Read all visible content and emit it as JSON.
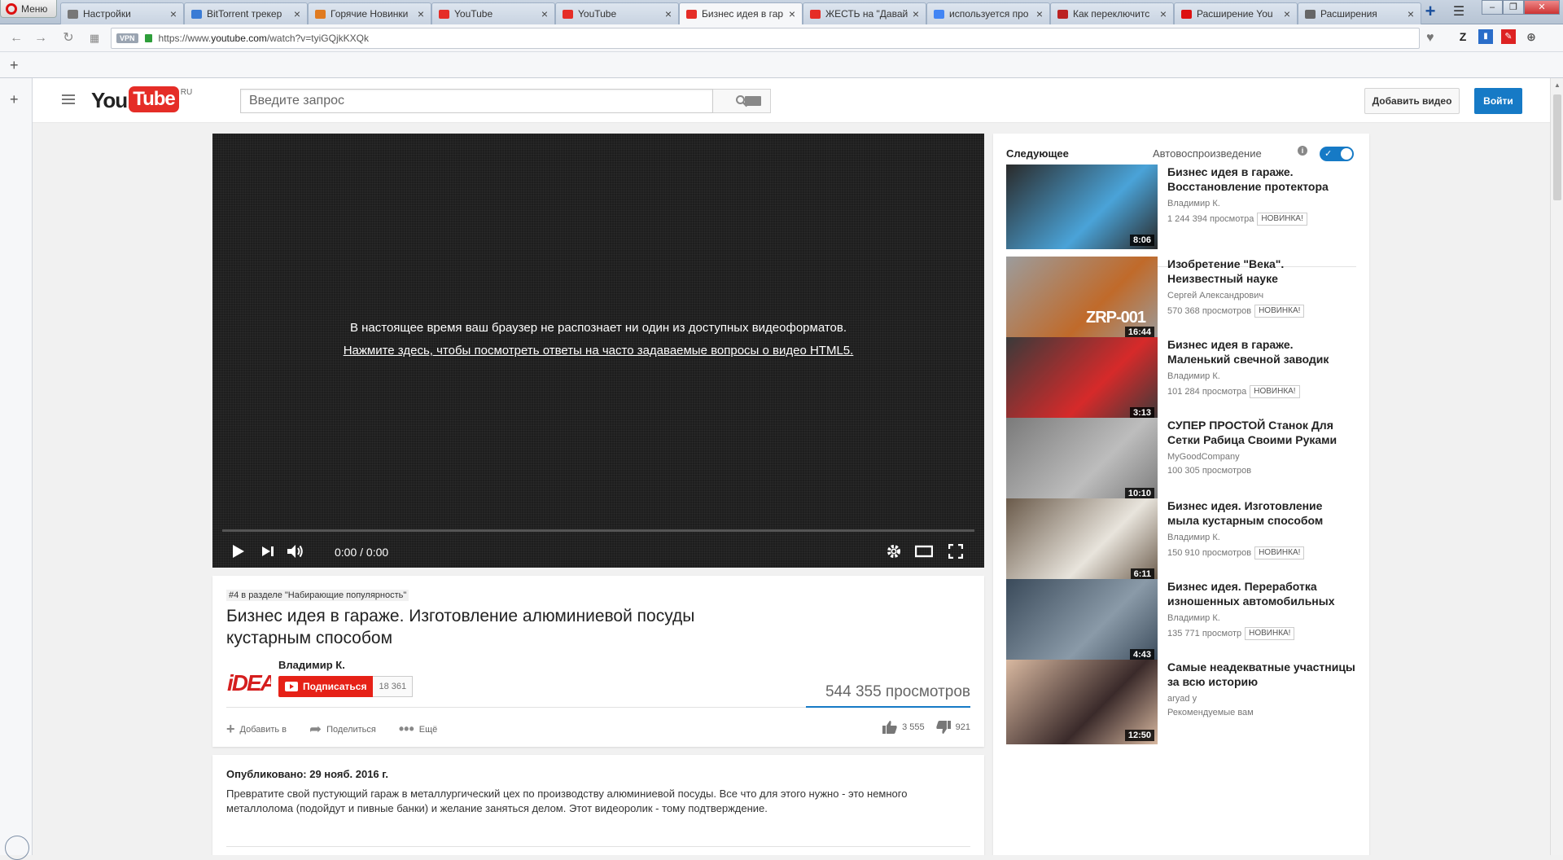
{
  "browser": {
    "menu_label": "Меню",
    "tabs": [
      {
        "label": "Настройки",
        "fav": "#777"
      },
      {
        "label": "BitTorrent трекер",
        "fav": "#3a7bd5"
      },
      {
        "label": "Горячие Новинки",
        "fav": "#e07b20"
      },
      {
        "label": "YouTube",
        "fav": "#e52d27"
      },
      {
        "label": "YouTube",
        "fav": "#e52d27"
      },
      {
        "label": "Бизнес идея в гар",
        "fav": "#e52d27"
      },
      {
        "label": "ЖЕСТЬ на \"Давай",
        "fav": "#e52d27"
      },
      {
        "label": "используется про",
        "fav": "#4285f4"
      },
      {
        "label": "Как переключитс",
        "fav": "#b22"
      },
      {
        "label": "Расширение You",
        "fav": "#d11"
      },
      {
        "label": "Расширения",
        "fav": "#666"
      }
    ],
    "active_tab": 5,
    "vpn_label": "VPN",
    "url_prefix": "https://www.",
    "url_host": "youtube.com",
    "url_path": "/watch?v=tyiGQjkKXQk"
  },
  "header": {
    "logo_you": "You",
    "logo_tube": "Tube",
    "logo_region": "RU",
    "search_placeholder": "Введите запрос",
    "upload_label": "Добавить видео",
    "signin_label": "Войти"
  },
  "player": {
    "message": "В настоящее время ваш браузер не распознает ни один из доступных видеоформатов.",
    "link": "Нажмите здесь, чтобы посмотреть ответы на часто задаваемые вопросы о видео HTML5.",
    "time": "0:00 / 0:00",
    "progress": 0
  },
  "video": {
    "trending": "#4 в разделе \"Набирающие популярность\"",
    "title": "Бизнес идея в гараже. Изготовление алюминиевой посуды кустарным способом",
    "channel": "Владимир К.",
    "avatar_text": "iDEA",
    "subscribe_label": "Подписаться",
    "subscribers": "18 361",
    "views": "544 355 просмотров",
    "add_label": "Добавить в",
    "share_label": "Поделиться",
    "more_label": "Ещё",
    "likes": "3 555",
    "dislikes": "921",
    "published": "Опубликовано: 29 нояб. 2016 г.",
    "description": "Превратите свой пустующий гараж в металлургический цех по производству алюминиевой посуды. Все что для этого нужно - это немного металлолома (подойдут и пивные банки) и желание заняться делом. Этот видеоролик - тому подтверждение."
  },
  "sidebar": {
    "next_label": "Следующее",
    "autoplay_label": "Автовоспроизведение",
    "autoplay_on": true,
    "items": [
      {
        "title": "Бизнес идея в гараже. Восстановление протектора",
        "channel": "Владимир К.",
        "views": "1 244 394 просмотра",
        "badge": "НОВИНКА!",
        "duration": "8:06",
        "thumb": [
          "#2a2a2a",
          "#4aa3d8"
        ]
      },
      {
        "title": "Изобретение \"Века\". Неизвестный науке",
        "channel": "Сергей Александрович",
        "views": "570 368 просмотров",
        "badge": "НОВИНКА!",
        "duration": "16:44",
        "thumb": [
          "#9c9c9c",
          "#c06a2a"
        ],
        "overlay": "ZRP-001"
      },
      {
        "title": "Бизнес идея в гараже. Маленький свечной заводик",
        "channel": "Владимир К.",
        "views": "101 284 просмотра",
        "badge": "НОВИНКА!",
        "duration": "3:13",
        "thumb": [
          "#3a3a3a",
          "#d62a2a"
        ]
      },
      {
        "title": "СУПЕР ПРОСТОЙ Станок Для Сетки Рабица Своими Руками",
        "channel": "MyGoodCompany",
        "views": "100 305 просмотров",
        "badge": "",
        "duration": "10:10",
        "thumb": [
          "#7a7a7a",
          "#bdbdbd"
        ]
      },
      {
        "title": "Бизнес идея. Изготовление мыла кустарным способом",
        "channel": "Владимир К.",
        "views": "150 910 просмотров",
        "badge": "НОВИНКА!",
        "duration": "6:11",
        "thumb": [
          "#6a5a4a",
          "#e8e4dc"
        ]
      },
      {
        "title": "Бизнес идея. Переработка изношенных автомобильных",
        "channel": "Владимир К.",
        "views": "135 771 просмотр",
        "badge": "НОВИНКА!",
        "duration": "4:43",
        "thumb": [
          "#3a4a5a",
          "#8a9aa8"
        ]
      },
      {
        "title": "Самые неадекватные участницы за всю историю",
        "channel": "aryad y",
        "views": "Рекомендуемые вам",
        "badge": "",
        "duration": "12:50",
        "thumb": [
          "#d8b8a0",
          "#3a2a2a"
        ]
      }
    ]
  }
}
